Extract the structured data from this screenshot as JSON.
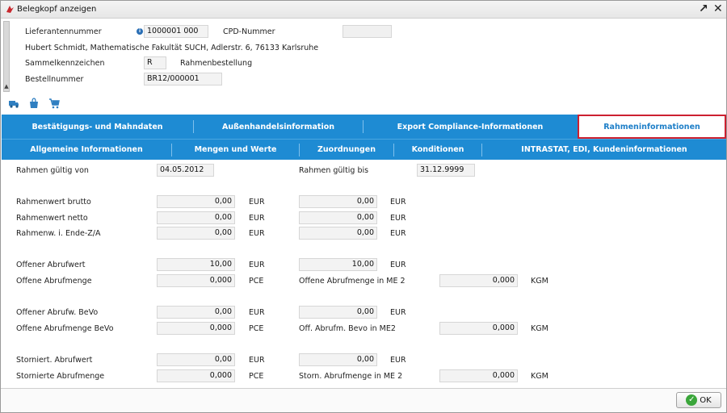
{
  "window": {
    "title": "Belegkopf anzeigen",
    "maximize": "↗",
    "close": "✕"
  },
  "header": {
    "supplier_label": "Lieferantennummer",
    "supplier_value": "1000001 000",
    "cpd_label": "CPD-Nummer",
    "cpd_value": "",
    "address": "Hubert Schmidt, Mathematische Fakultät SUCH, Adlerstr. 6, 76133 Karlsruhe",
    "collective_label": "Sammelkennzeichen",
    "collective_value": "R",
    "collective_text": "Rahmenbestellung",
    "order_label": "Bestellnummer",
    "order_value": "BR12/000001"
  },
  "toolbar": {
    "icons": [
      "truck-icon",
      "shopping-bag-icon",
      "shopping-cart-icon"
    ]
  },
  "tabs_row1": [
    "Bestätigungs- und Mahndaten",
    "Außenhandelsinformation",
    "Export Compliance-Informationen",
    "Rahmeninformationen"
  ],
  "tabs_row2": [
    "Allgemeine Informationen",
    "Mengen und Werte",
    "Zuordnungen",
    "Konditionen",
    "INTRASTAT, EDI, Kundeninformationen"
  ],
  "active_tab": "Rahmeninformationen",
  "content": {
    "valid_from_label": "Rahmen gültig von",
    "valid_from": "04.05.2012",
    "valid_to_label": "Rahmen gültig bis",
    "valid_to": "31.12.9999",
    "rows": {
      "brutto": {
        "label": "Rahmenwert brutto",
        "v1": "0,00",
        "u1": "EUR",
        "v2": "0,00",
        "u2": "EUR"
      },
      "netto": {
        "label": "Rahmenwert netto",
        "v1": "0,00",
        "u1": "EUR",
        "v2": "0,00",
        "u2": "EUR"
      },
      "ende": {
        "label": "Rahmenw. i. Ende-Z/A",
        "v1": "0,00",
        "u1": "EUR",
        "v2": "0,00",
        "u2": "EUR"
      },
      "abrufwert": {
        "label": "Offener Abrufwert",
        "v1": "10,00",
        "u1": "EUR",
        "v2": "10,00",
        "u2": "EUR"
      },
      "abrufmenge": {
        "label": "Offene Abrufmenge",
        "v1": "0,000",
        "u1": "PCE",
        "label2": "Offene Abrufmenge in ME 2",
        "v2": "0,000",
        "u2": "KGM"
      },
      "bevo": {
        "label": "Offener Abrufw. BeVo",
        "v1": "0,00",
        "u1": "EUR",
        "v2": "0,00",
        "u2": "EUR"
      },
      "bevo_menge": {
        "label": "Offene Abrufmenge BeVo",
        "v1": "0,000",
        "u1": "PCE",
        "label2": "Off. Abrufm. Bevo in ME2",
        "v2": "0,000",
        "u2": "KGM"
      },
      "storno": {
        "label": "Storniert. Abrufwert",
        "v1": "0,00",
        "u1": "EUR",
        "v2": "0,00",
        "u2": "EUR"
      },
      "storno_menge": {
        "label": "Stornierte Abrufmenge",
        "v1": "0,000",
        "u1": "PCE",
        "label2": "Storn. Abrufmenge in ME 2",
        "v2": "0,000",
        "u2": "KGM"
      }
    }
  },
  "footer": {
    "ok_label": "OK"
  },
  "colors": {
    "tab_blue": "#1e8bd3",
    "active_border": "#cc2030",
    "ok_green": "#3aa63a"
  }
}
